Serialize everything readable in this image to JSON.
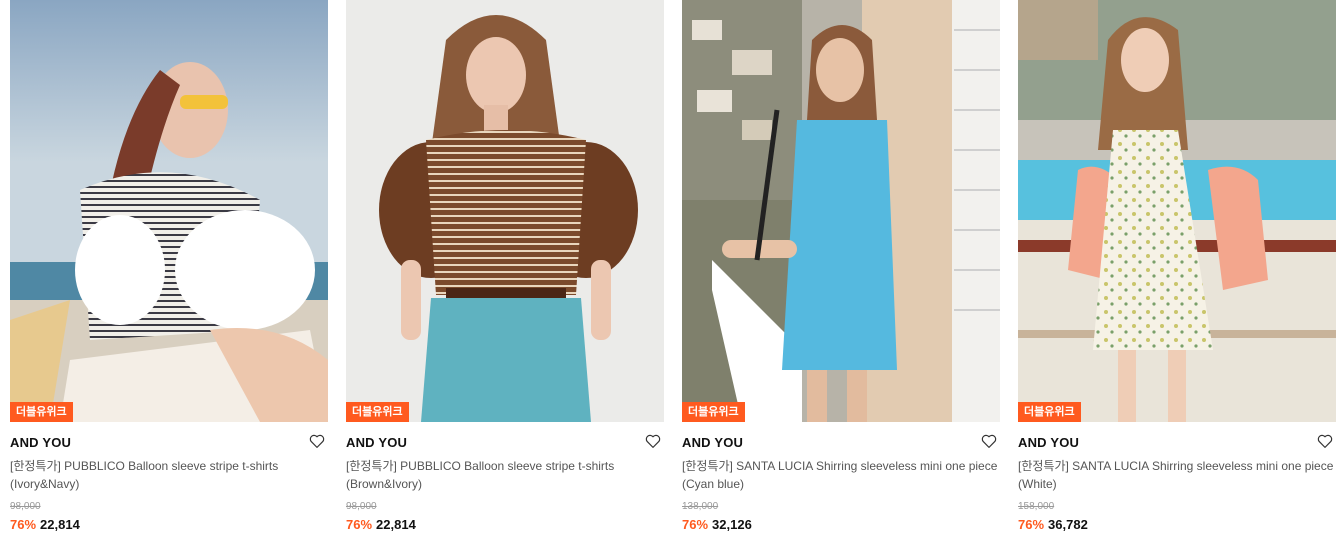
{
  "products": [
    {
      "badge": "더블유위크",
      "brand": "AND YOU",
      "title": "[한정특가] PUBBLICO Balloon sleeve stripe t-shirts (Ivory&Navy)",
      "original_price": "98,000",
      "discount": "76%",
      "price": "22,814"
    },
    {
      "badge": "더블유위크",
      "brand": "AND YOU",
      "title": "[한정특가] PUBBLICO Balloon sleeve stripe t-shirts (Brown&Ivory)",
      "original_price": "98,000",
      "discount": "76%",
      "price": "22,814"
    },
    {
      "badge": "더블유위크",
      "brand": "AND YOU",
      "title": "[한정특가] SANTA LUCIA Shirring sleeveless mini one piece (Cyan blue)",
      "original_price": "138,000",
      "discount": "76%",
      "price": "32,126"
    },
    {
      "badge": "더블유위크",
      "brand": "AND YOU",
      "title": "[한정특가] SANTA LUCIA Shirring sleeveless mini one piece (White)",
      "original_price": "158,000",
      "discount": "76%",
      "price": "36,782"
    }
  ],
  "colors": {
    "accent": "#ff5a1f",
    "badge_text": "#ffffff"
  },
  "icons": {
    "wishlist": "heart-outline-icon"
  }
}
